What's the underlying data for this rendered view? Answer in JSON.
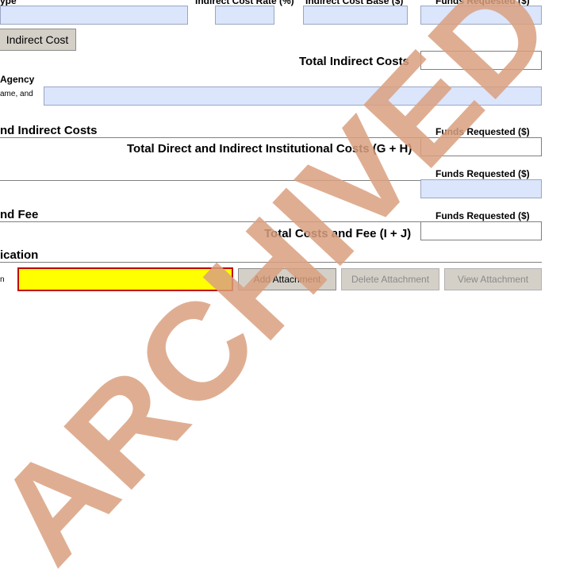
{
  "indirect_cost_header": {
    "type_label": "ype",
    "rate_label": "Indirect Cost  Rate (%)",
    "base_label": "Indirect Cost  Base ($)",
    "funds_label": "Funds Requested ($)"
  },
  "indirect_cost_button": "Indirect Cost",
  "total_indirect_costs_label": "Total Indirect Costs",
  "cognizant_agency": {
    "label_line1": "Agency",
    "label_line2": "ame, and"
  },
  "section_direct_indirect": {
    "title": "nd Indirect Costs",
    "funds_label": "Funds Requested ($)",
    "total_label": "Total Direct and Indirect Institutional Costs (G + H)"
  },
  "section_fee": {
    "funds_label": "Funds Requested ($)"
  },
  "section_total_costs_fee": {
    "title": "nd Fee",
    "funds_label": "Funds Requested ($)",
    "total_label": "Total Costs and Fee (I + J)"
  },
  "section_justification": {
    "title": "ication",
    "row_label": "n"
  },
  "attachment_buttons": {
    "add": "Add Attachment",
    "delete": "Delete Attachment",
    "view": "View Attachment"
  },
  "watermark_text": "ARCHIVED",
  "colors": {
    "field_fill": "#dbe5fb",
    "required_fill": "#ffff00",
    "required_border": "#c00000",
    "watermark": "#d9a07f"
  }
}
